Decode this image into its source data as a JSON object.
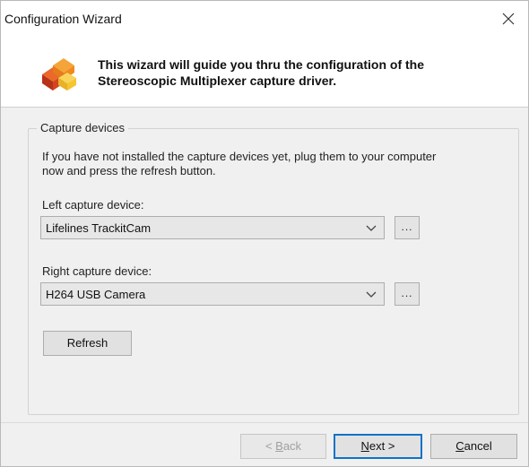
{
  "window": {
    "title": "Configuration Wizard",
    "close_icon": "close-icon"
  },
  "header": {
    "icon": "wizard-cubes-icon",
    "text_line1": "This wizard will guide you thru the configuration of the",
    "text_line2": "Stereoscopic Multiplexer capture driver."
  },
  "group": {
    "legend": "Capture devices",
    "instructions_line1": "If you have not installed the capture devices yet, plug them to your computer",
    "instructions_line2": "now and press the refresh button.",
    "left_label": "Left capture device:",
    "left_value": "Lifelines TrackitCam",
    "left_browse": "...",
    "right_label": "Right capture device:",
    "right_value": "H264 USB Camera",
    "right_browse": "...",
    "refresh_label": "Refresh"
  },
  "footer": {
    "back_prefix": "< ",
    "back_mnemonic": "B",
    "back_rest": "ack",
    "next_mnemonic": "N",
    "next_rest": "ext >",
    "cancel_mnemonic": "C",
    "cancel_rest": "ancel"
  },
  "colors": {
    "accent": "#0f72c7",
    "icon_red": "#d2451e",
    "icon_orange": "#f08a1c",
    "icon_yellow": "#f6c531"
  }
}
